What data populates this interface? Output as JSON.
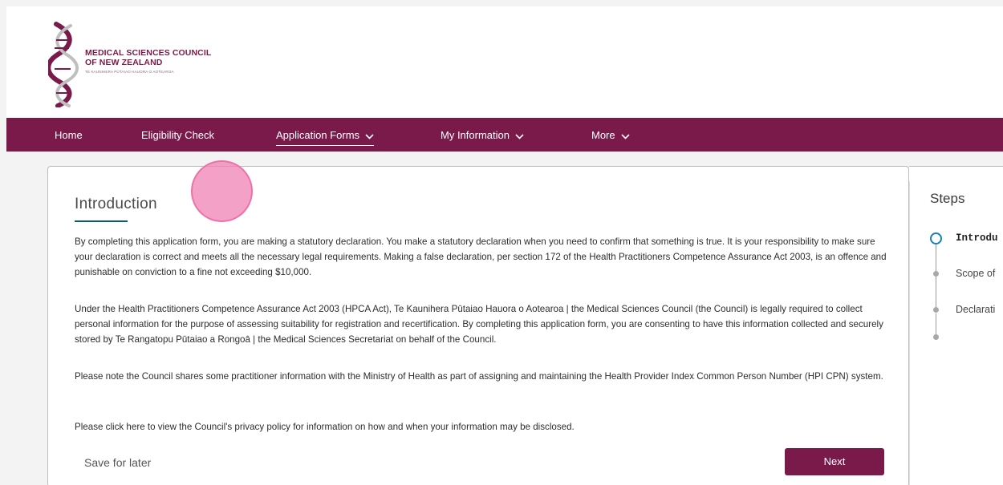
{
  "logo": {
    "line1": "MEDICAL SCIENCES COUNCIL",
    "line2": "OF NEW ZEALAND",
    "sub": "TE KAUNIHERA PŪTAIAO HAUORA O AOTEAROA",
    "brand_color": "#7a1a4a"
  },
  "nav": {
    "items": [
      {
        "label": "Home",
        "dropdown": false
      },
      {
        "label": "Eligibility Check",
        "dropdown": false
      },
      {
        "label": "Application Forms",
        "dropdown": true,
        "active": true
      },
      {
        "label": "My Information",
        "dropdown": true
      },
      {
        "label": "More",
        "dropdown": true
      }
    ]
  },
  "main": {
    "title": "Introduction",
    "paragraphs": [
      "By completing this application form, you are making a statutory declaration.  You make a statutory declaration when you need to confirm that something is true. It is your responsibility to make sure your declaration is correct and meets all the necessary legal requirements. Making a false declaration, per section 172 of the Health Practitioners Competence Assurance Act 2003, is an offence and punishable on conviction to a fine not exceeding $10,000.",
      "Under the Health Practitioners Competence Assurance Act 2003 (HPCA Act), Te Kaunihera Pūtaiao Hauora o Aotearoa | the Medical Sciences Council (the Council) is legally required to collect personal information for the purpose of assessing suitability for registration and recertification. By completing this application form, you are consenting to have this information collected and securely stored by Te Rangatopu Pūtaiao a Rongoā | the Medical Sciences Secretariat on behalf of the Council.",
      "Please note the Council shares some practitioner information with the Ministry of Health as part of assigning and maintaining the Health Provider Index Common Person Number (HPI CPN) system.",
      "Please click here to view the Council's privacy policy for information on how and when your information may be disclosed."
    ],
    "save_label": "Save for later",
    "next_label": "Next"
  },
  "steps": {
    "title": "Steps",
    "items": [
      {
        "label": "Introdu",
        "state": "active"
      },
      {
        "label": "Scope of",
        "state": "pending"
      },
      {
        "label": "Declarati",
        "state": "pending"
      },
      {
        "label": "",
        "state": "pending"
      }
    ]
  },
  "colors": {
    "nav_background": "#7a1a4a",
    "active_step": "#1a7fb5",
    "title_underline": "#0a5a7a"
  }
}
